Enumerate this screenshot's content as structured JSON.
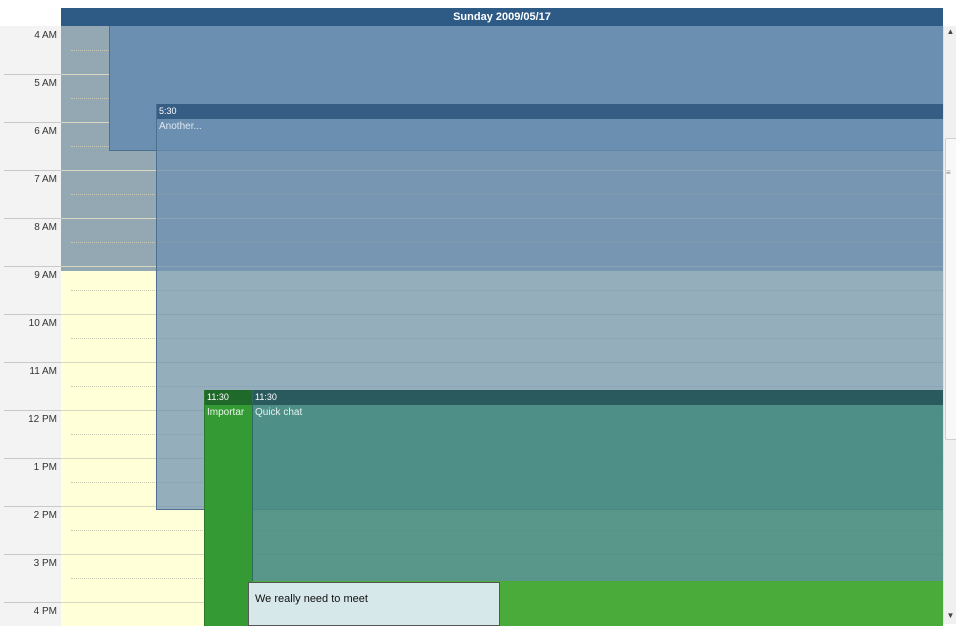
{
  "header": {
    "title": "Sunday 2009/05/17"
  },
  "hours": [
    "4 AM",
    "5 AM",
    "6 AM",
    "7 AM",
    "8 AM",
    "9 AM",
    "10 AM",
    "11 AM",
    "12 PM",
    "1 PM",
    "2 PM",
    "3 PM",
    "4 PM"
  ],
  "events": [
    {
      "id": "another",
      "start_label": "5:30",
      "title": "Another..."
    },
    {
      "id": "important",
      "start_label": "11:30",
      "title": "Importar"
    },
    {
      "id": "quick-chat",
      "start_label": "11:30",
      "title": "Quick chat"
    }
  ],
  "popup": {
    "text": "We really need to meet"
  },
  "colors": {
    "header": "#2e5a86",
    "blue_event": "#6b8fb0",
    "teal_event": "#4e8f88",
    "green_event": "#3a9a3a",
    "workday": "#ffffd8",
    "offhours": "#93a8b2"
  }
}
